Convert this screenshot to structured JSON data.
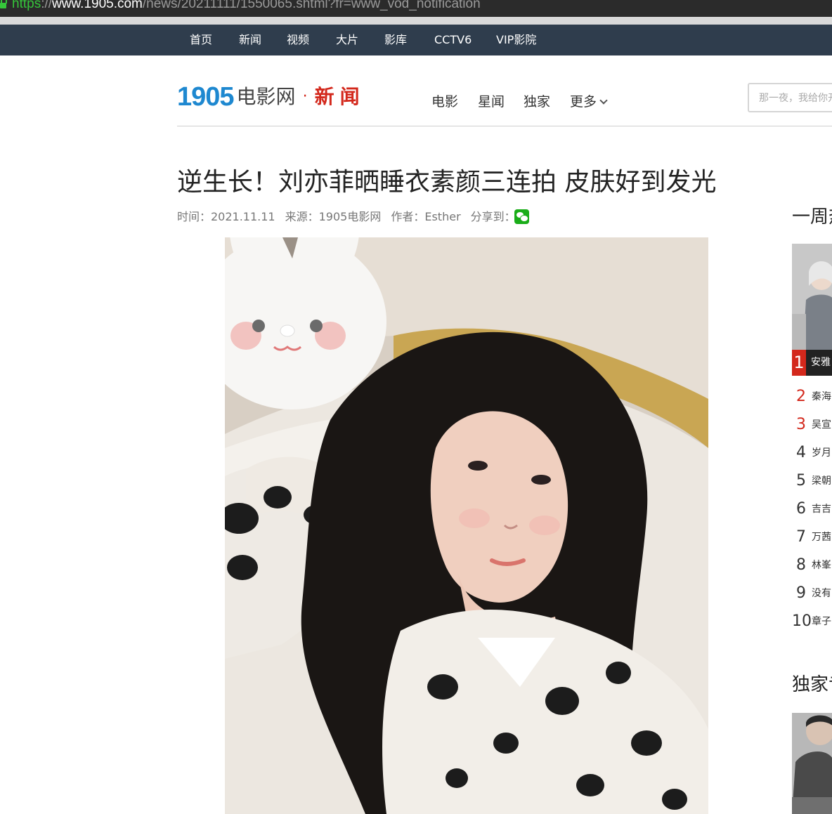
{
  "browser": {
    "url_scheme": "https",
    "url_sep": "://",
    "url_host": "www.1905.com",
    "url_path": "/news/20211111/1550065.shtml?fr=www_vod_notification"
  },
  "top_nav": [
    "首页",
    "新闻",
    "视频",
    "大片",
    "影库",
    "CCTV6",
    "VIP影院"
  ],
  "header": {
    "logo_number": "1905",
    "logo_brand": "电影网",
    "logo_dot": "·",
    "logo_section": "新闻",
    "categories": [
      "电影",
      "星闻",
      "独家"
    ],
    "more": "更多",
    "search_placeholder": "那一夜，我给你开过车"
  },
  "article": {
    "title": "逆生长！刘亦菲晒睡衣素颜三连拍 皮肤好到发光",
    "time": "时间：2021.11.11",
    "source": "来源：1905电影网",
    "author": "作者：Esther",
    "share": "分享到："
  },
  "sidebar": {
    "weekly_title": "一周热",
    "exclusive_title": "独家专",
    "rank_first": {
      "num": "1",
      "title": "安雅"
    },
    "ranks": [
      {
        "num": "2",
        "title": "秦海"
      },
      {
        "num": "3",
        "title": "吴宣"
      },
      {
        "num": "4",
        "title": "岁月"
      },
      {
        "num": "5",
        "title": "梁朝"
      },
      {
        "num": "6",
        "title": "吉吉"
      },
      {
        "num": "7",
        "title": "万茜"
      },
      {
        "num": "8",
        "title": "林峯"
      },
      {
        "num": "9",
        "title": "没有"
      },
      {
        "num": "10",
        "title": "章子"
      }
    ]
  },
  "colors": {
    "nav_bg": "#2f3d4d",
    "logo_blue": "#1e88d0",
    "accent_red": "#d3281c",
    "wechat_green": "#1aad19"
  }
}
